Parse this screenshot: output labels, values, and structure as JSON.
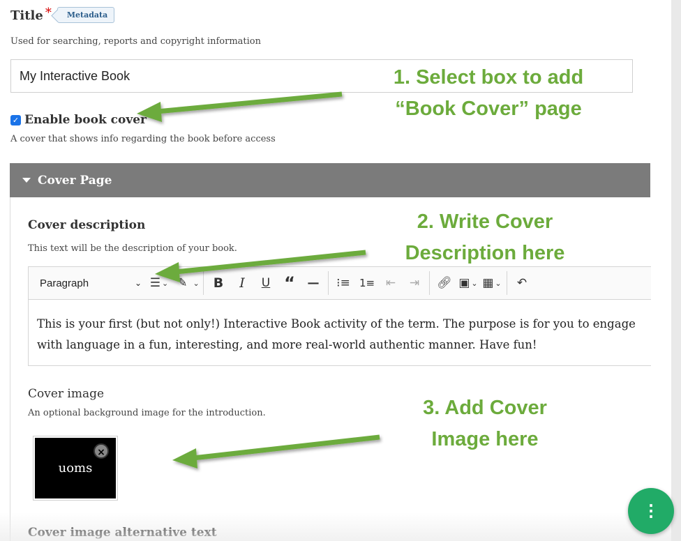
{
  "title_field": {
    "label": "Title",
    "required_marker": "*",
    "metadata_button": "Metadata",
    "description": "Used for searching, reports and copyright information",
    "value": "My Interactive Book"
  },
  "book_cover": {
    "checked": true,
    "label": "Enable book cover",
    "description": "A cover that shows info regarding the book before access"
  },
  "cover_page": {
    "header": "Cover Page",
    "description_section": {
      "title": "Cover description",
      "help": "This text will be the description of your book.",
      "toolbar": {
        "paragraph_label": "Paragraph",
        "icons": [
          "align-icon",
          "highlight-icon",
          "bold-icon",
          "italic-icon",
          "underline-icon",
          "quote-icon",
          "horizontal-line-icon",
          "bullet-list-icon",
          "numbered-list-icon",
          "outdent-icon",
          "indent-icon",
          "link-icon",
          "media-icon",
          "table-icon",
          "undo-icon"
        ]
      },
      "content": "This is your first (but not only!) Interactive Book activity of the term. The purpose is for you to engage with language in a fun, interesting, and more real-world authentic manner. Have fun!"
    },
    "image_section": {
      "title": "Cover image",
      "help": "An optional background image for the introduction.",
      "thumbnail_text": "uoms"
    },
    "alt_text_section": {
      "title": "Cover image alternative text"
    }
  },
  "annotations": {
    "step1_line1": "1. Select box to add",
    "step1_line2": "“Book Cover” page",
    "step2_line1": "2. Write Cover",
    "step2_line2": "Description here",
    "step3_line1": "3. Add Cover",
    "step3_line2": "Image here",
    "color": "#6cab3c"
  },
  "colors": {
    "checkbox": "#1a73e8",
    "header_bar": "#7b7b7b",
    "fab": "#21ab67",
    "required": "#d60000"
  }
}
